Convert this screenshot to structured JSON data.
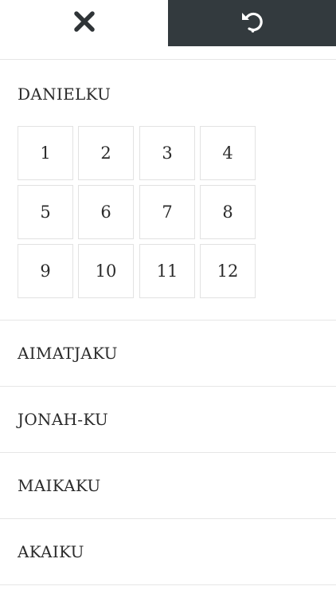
{
  "toolbar": {
    "close_icon": "close-icon",
    "reset_icon": "undo-icon",
    "accent_dark": "#333a3e"
  },
  "books": [
    {
      "name": "DANIELKU",
      "expanded": true,
      "chapters": [
        "1",
        "2",
        "3",
        "4",
        "5",
        "6",
        "7",
        "8",
        "9",
        "10",
        "11",
        "12"
      ]
    },
    {
      "name": "AIMATJAKU",
      "expanded": false
    },
    {
      "name": "JONAH-KU",
      "expanded": false
    },
    {
      "name": "MAIKAKU",
      "expanded": false
    },
    {
      "name": "AKAIKU",
      "expanded": false
    }
  ]
}
